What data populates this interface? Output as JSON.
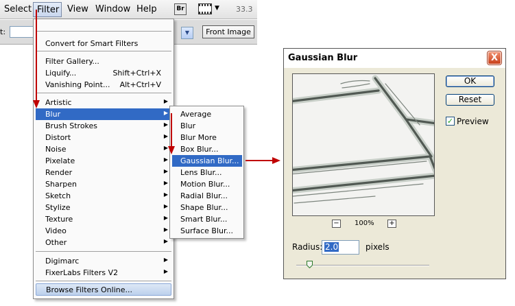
{
  "menubar": {
    "items": [
      "Select",
      "Filter",
      "View",
      "Window",
      "Help"
    ],
    "br_label": "Br",
    "zoom_readout": "33.3"
  },
  "optionsbar": {
    "label": "t:",
    "front_image_label": "Front Image"
  },
  "filter_menu": {
    "convert": "Convert for Smart Filters",
    "gallery": "Filter Gallery...",
    "liquify": {
      "label": "Liquify...",
      "shortcut": "Shift+Ctrl+X"
    },
    "vanishing": {
      "label": "Vanishing Point...",
      "shortcut": "Alt+Ctrl+V"
    },
    "groups": [
      "Artistic",
      "Blur",
      "Brush Strokes",
      "Distort",
      "Noise",
      "Pixelate",
      "Render",
      "Sharpen",
      "Sketch",
      "Stylize",
      "Texture",
      "Video",
      "Other"
    ],
    "plugins": [
      "Digimarc",
      "FixerLabs Filters V2"
    ],
    "browse": "Browse Filters Online..."
  },
  "blur_submenu": {
    "items": [
      "Average",
      "Blur",
      "Blur More",
      "Box Blur...",
      "Gaussian Blur...",
      "Lens Blur...",
      "Motion Blur...",
      "Radial Blur...",
      "Shape Blur...",
      "Smart Blur...",
      "Surface Blur..."
    ],
    "selected_index": 4
  },
  "dialog": {
    "title": "Gaussian Blur",
    "close_glyph": "X",
    "ok_label": "OK",
    "reset_label": "Reset",
    "preview_label": "Preview",
    "preview_checked": true,
    "zoom_value": "100%",
    "zoom_out_glyph": "−",
    "zoom_in_glyph": "+",
    "radius_label": "Radius:",
    "radius_value": "2.0",
    "units": "pixels",
    "slider_fraction": 0.1
  },
  "colors": {
    "menu_highlight": "#316ac5",
    "arrow": "#c00000",
    "dialog_bg": "#ece9d8"
  }
}
